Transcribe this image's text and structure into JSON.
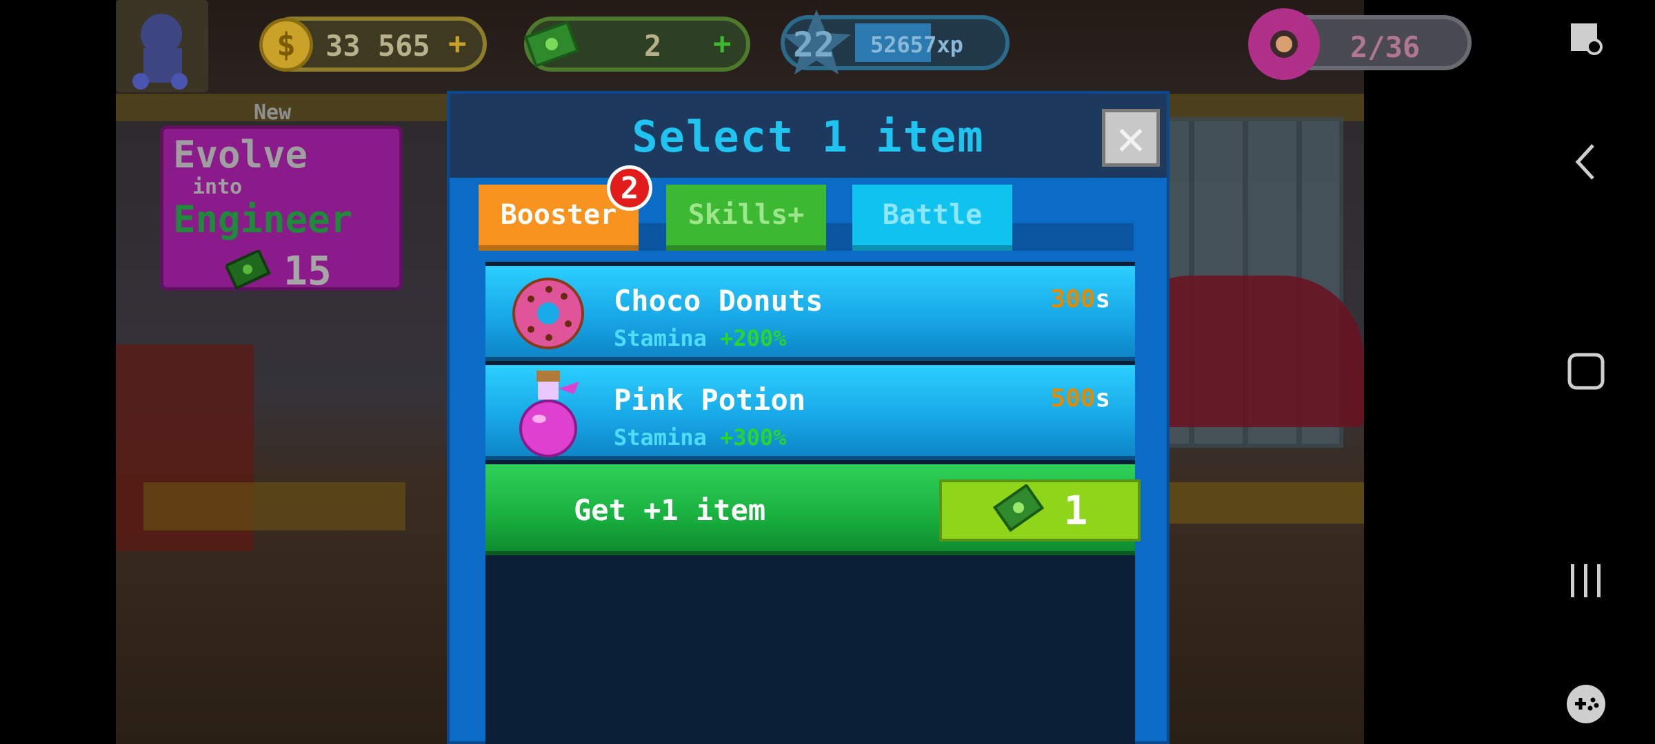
{
  "hud": {
    "coins": "33 565",
    "cash": "2",
    "level": "22",
    "xp": "52657xp",
    "donuts": "2/36"
  },
  "evolve": {
    "new_label": "New",
    "line1": "Evolve",
    "line2": "into",
    "line3": "Engineer",
    "cost": "15"
  },
  "modal": {
    "title": "Select 1 item",
    "tabs": [
      {
        "label": "Booster",
        "badge": "2"
      },
      {
        "label": "Skills+"
      },
      {
        "label": "Battle"
      }
    ],
    "items": [
      {
        "name": "Choco Donuts",
        "stat_label": "Stamina",
        "stat_value": "+200%",
        "time": "300",
        "time_unit": "s"
      },
      {
        "name": "Pink Potion",
        "stat_label": "Stamina",
        "stat_value": "+300%",
        "time": "500",
        "time_unit": "s"
      }
    ],
    "get_more": {
      "label": "Get +1 item",
      "price": "1"
    }
  },
  "colors": {
    "accent_title": "#1fc4f0",
    "booster_tab": "#f7931e",
    "skills_tab": "#3cb832",
    "battle_tab": "#10c2ee",
    "time_value": "#e28a00",
    "stat_bonus": "#2bd62b"
  },
  "icons": [
    "hero-avatar-icon",
    "gold-coin-icon",
    "cash-icon",
    "xp-star-icon",
    "donut-icon",
    "close-icon",
    "potion-icon",
    "screenshot-icon",
    "back-icon",
    "home-icon",
    "recents-icon",
    "game-tools-icon"
  ]
}
